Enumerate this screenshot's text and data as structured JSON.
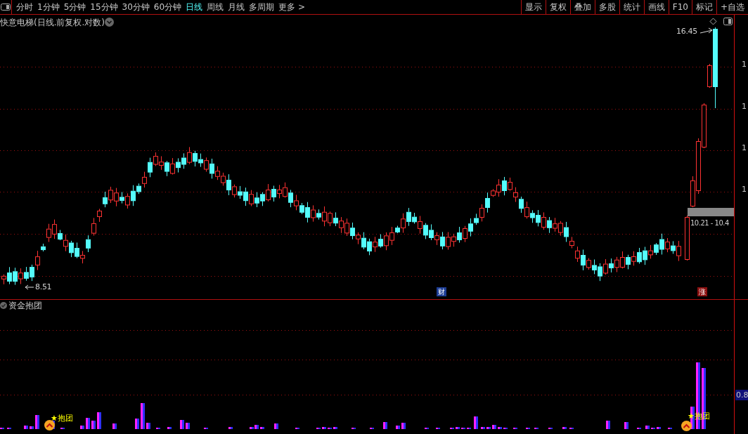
{
  "toolbar": {
    "periods": [
      {
        "label": "分时",
        "selected": false
      },
      {
        "label": "1分钟",
        "selected": false
      },
      {
        "label": "5分钟",
        "selected": false
      },
      {
        "label": "15分钟",
        "selected": false
      },
      {
        "label": "30分钟",
        "selected": false
      },
      {
        "label": "60分钟",
        "selected": false
      },
      {
        "label": "日线",
        "selected": true
      },
      {
        "label": "周线",
        "selected": false
      },
      {
        "label": "月线",
        "selected": false
      },
      {
        "label": "多周期",
        "selected": false
      }
    ],
    "more": "更多 >",
    "tools": [
      "显示",
      "复权",
      "叠加",
      "多股",
      "统计",
      "画线",
      "F10",
      "标记",
      "+自选"
    ]
  },
  "chart": {
    "title": "快意电梯(日线.前复权.对数)",
    "axis_labels": [
      "1",
      "1",
      "1",
      "1"
    ],
    "high_label": "16.45",
    "low_label": "8.51",
    "range_label": "10.21 - 10.4",
    "badges": [
      {
        "label": "财",
        "color": "#1c3c94"
      },
      {
        "label": "涨",
        "color": "#8a1010"
      }
    ]
  },
  "indicator": {
    "title": "资金抱团",
    "value_label": "0.8",
    "signals": [
      "★抱团",
      "★抱团"
    ]
  }
}
